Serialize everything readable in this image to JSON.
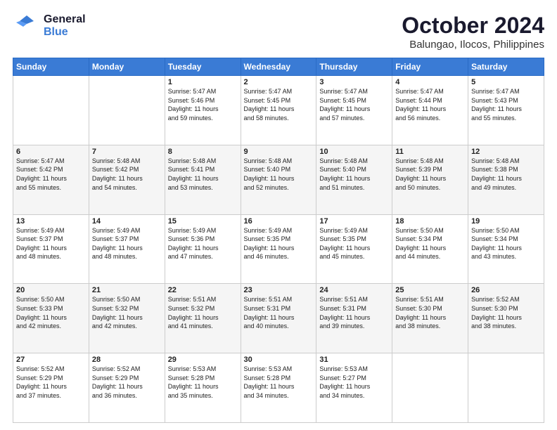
{
  "logo": {
    "line1": "General",
    "line2": "Blue"
  },
  "title": "October 2024",
  "subtitle": "Balungao, Ilocos, Philippines",
  "weekdays": [
    "Sunday",
    "Monday",
    "Tuesday",
    "Wednesday",
    "Thursday",
    "Friday",
    "Saturday"
  ],
  "weeks": [
    [
      {
        "day": "",
        "info": ""
      },
      {
        "day": "",
        "info": ""
      },
      {
        "day": "1",
        "info": "Sunrise: 5:47 AM\nSunset: 5:46 PM\nDaylight: 11 hours\nand 59 minutes."
      },
      {
        "day": "2",
        "info": "Sunrise: 5:47 AM\nSunset: 5:45 PM\nDaylight: 11 hours\nand 58 minutes."
      },
      {
        "day": "3",
        "info": "Sunrise: 5:47 AM\nSunset: 5:45 PM\nDaylight: 11 hours\nand 57 minutes."
      },
      {
        "day": "4",
        "info": "Sunrise: 5:47 AM\nSunset: 5:44 PM\nDaylight: 11 hours\nand 56 minutes."
      },
      {
        "day": "5",
        "info": "Sunrise: 5:47 AM\nSunset: 5:43 PM\nDaylight: 11 hours\nand 55 minutes."
      }
    ],
    [
      {
        "day": "6",
        "info": "Sunrise: 5:47 AM\nSunset: 5:42 PM\nDaylight: 11 hours\nand 55 minutes."
      },
      {
        "day": "7",
        "info": "Sunrise: 5:48 AM\nSunset: 5:42 PM\nDaylight: 11 hours\nand 54 minutes."
      },
      {
        "day": "8",
        "info": "Sunrise: 5:48 AM\nSunset: 5:41 PM\nDaylight: 11 hours\nand 53 minutes."
      },
      {
        "day": "9",
        "info": "Sunrise: 5:48 AM\nSunset: 5:40 PM\nDaylight: 11 hours\nand 52 minutes."
      },
      {
        "day": "10",
        "info": "Sunrise: 5:48 AM\nSunset: 5:40 PM\nDaylight: 11 hours\nand 51 minutes."
      },
      {
        "day": "11",
        "info": "Sunrise: 5:48 AM\nSunset: 5:39 PM\nDaylight: 11 hours\nand 50 minutes."
      },
      {
        "day": "12",
        "info": "Sunrise: 5:48 AM\nSunset: 5:38 PM\nDaylight: 11 hours\nand 49 minutes."
      }
    ],
    [
      {
        "day": "13",
        "info": "Sunrise: 5:49 AM\nSunset: 5:37 PM\nDaylight: 11 hours\nand 48 minutes."
      },
      {
        "day": "14",
        "info": "Sunrise: 5:49 AM\nSunset: 5:37 PM\nDaylight: 11 hours\nand 48 minutes."
      },
      {
        "day": "15",
        "info": "Sunrise: 5:49 AM\nSunset: 5:36 PM\nDaylight: 11 hours\nand 47 minutes."
      },
      {
        "day": "16",
        "info": "Sunrise: 5:49 AM\nSunset: 5:35 PM\nDaylight: 11 hours\nand 46 minutes."
      },
      {
        "day": "17",
        "info": "Sunrise: 5:49 AM\nSunset: 5:35 PM\nDaylight: 11 hours\nand 45 minutes."
      },
      {
        "day": "18",
        "info": "Sunrise: 5:50 AM\nSunset: 5:34 PM\nDaylight: 11 hours\nand 44 minutes."
      },
      {
        "day": "19",
        "info": "Sunrise: 5:50 AM\nSunset: 5:34 PM\nDaylight: 11 hours\nand 43 minutes."
      }
    ],
    [
      {
        "day": "20",
        "info": "Sunrise: 5:50 AM\nSunset: 5:33 PM\nDaylight: 11 hours\nand 42 minutes."
      },
      {
        "day": "21",
        "info": "Sunrise: 5:50 AM\nSunset: 5:32 PM\nDaylight: 11 hours\nand 42 minutes."
      },
      {
        "day": "22",
        "info": "Sunrise: 5:51 AM\nSunset: 5:32 PM\nDaylight: 11 hours\nand 41 minutes."
      },
      {
        "day": "23",
        "info": "Sunrise: 5:51 AM\nSunset: 5:31 PM\nDaylight: 11 hours\nand 40 minutes."
      },
      {
        "day": "24",
        "info": "Sunrise: 5:51 AM\nSunset: 5:31 PM\nDaylight: 11 hours\nand 39 minutes."
      },
      {
        "day": "25",
        "info": "Sunrise: 5:51 AM\nSunset: 5:30 PM\nDaylight: 11 hours\nand 38 minutes."
      },
      {
        "day": "26",
        "info": "Sunrise: 5:52 AM\nSunset: 5:30 PM\nDaylight: 11 hours\nand 38 minutes."
      }
    ],
    [
      {
        "day": "27",
        "info": "Sunrise: 5:52 AM\nSunset: 5:29 PM\nDaylight: 11 hours\nand 37 minutes."
      },
      {
        "day": "28",
        "info": "Sunrise: 5:52 AM\nSunset: 5:29 PM\nDaylight: 11 hours\nand 36 minutes."
      },
      {
        "day": "29",
        "info": "Sunrise: 5:53 AM\nSunset: 5:28 PM\nDaylight: 11 hours\nand 35 minutes."
      },
      {
        "day": "30",
        "info": "Sunrise: 5:53 AM\nSunset: 5:28 PM\nDaylight: 11 hours\nand 34 minutes."
      },
      {
        "day": "31",
        "info": "Sunrise: 5:53 AM\nSunset: 5:27 PM\nDaylight: 11 hours\nand 34 minutes."
      },
      {
        "day": "",
        "info": ""
      },
      {
        "day": "",
        "info": ""
      }
    ]
  ]
}
